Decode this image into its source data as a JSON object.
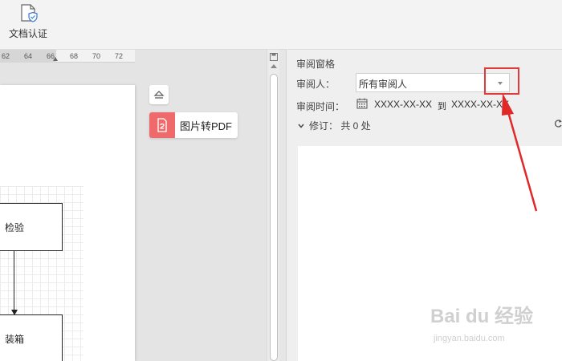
{
  "ribbon": {
    "doc_auth_label": "文档认证",
    "doc_auth_icon": "document-shield-icon"
  },
  "ruler": {
    "ticks": [
      "62",
      "64",
      "66",
      "68",
      "70",
      "72"
    ]
  },
  "flowchart": {
    "box1": "检验",
    "box2": "装箱"
  },
  "side_tools": {
    "collapse_icon": "eject-icon",
    "pdf_label": "图片转PDF",
    "pdf_icon": "picture-to-pdf-icon"
  },
  "review_pane": {
    "title": "审阅窗格",
    "reviewer_label": "审阅人：",
    "reviewer_value": "所有审阅人",
    "time_label": "审阅时间：",
    "time_start": "XXXX-XX-XX",
    "time_sep": "到",
    "time_end": "XXXX-XX-XX",
    "revision_count": "修订： 共 0 处"
  },
  "watermark": {
    "main": "Bai du 经验",
    "sub": "jingyan.baidu.com"
  },
  "colors": {
    "highlight": "#e03a3a",
    "pdf_accent": "#ef6b6b"
  }
}
